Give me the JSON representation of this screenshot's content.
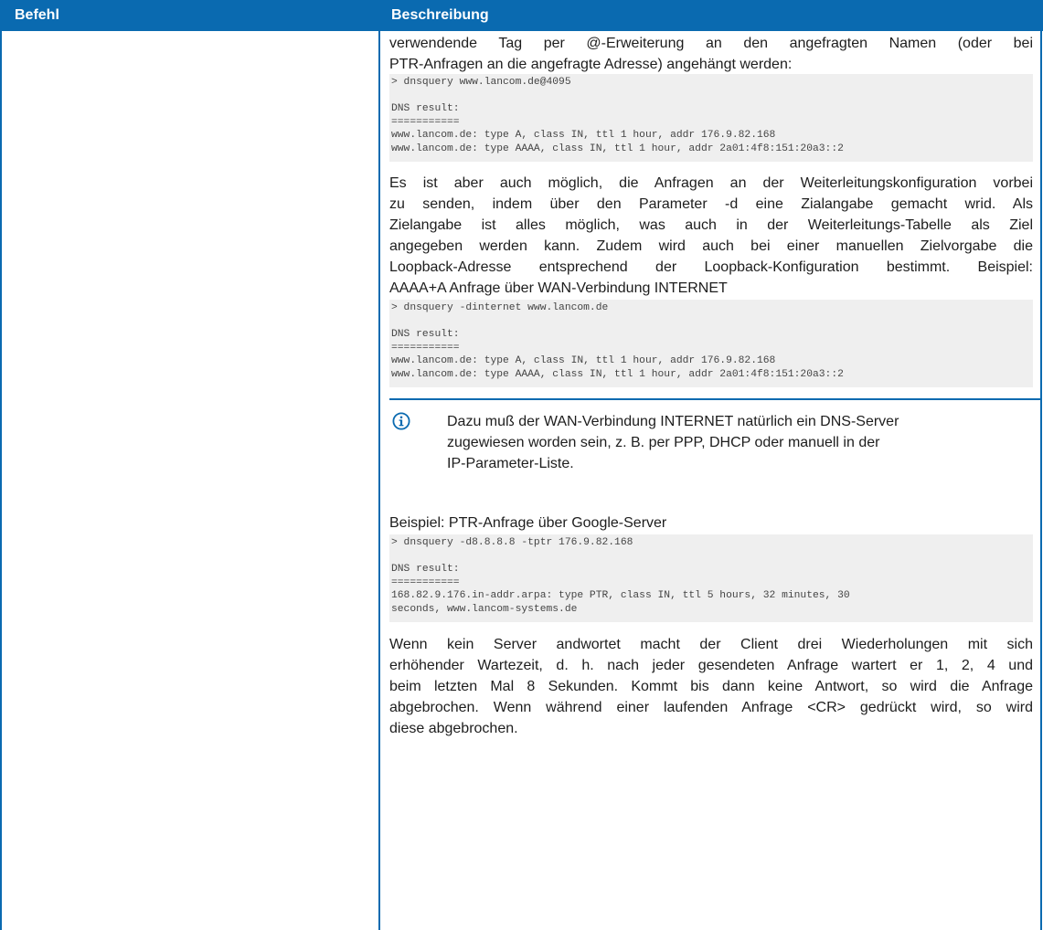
{
  "table": {
    "header": {
      "command": "Befehl",
      "description": "Beschreibung"
    }
  },
  "content": {
    "intro_lines": [
      "verwendende Tag per @-Erweiterung an den angefragten Namen (oder bei",
      "PTR-Anfragen an die angefragte Adresse) angehängt werden:"
    ],
    "code1": "> dnsquery www.lancom.de@4095\n\nDNS result:\n===========\nwww.lancom.de: type A, class IN, ttl 1 hour, addr 176.9.82.168\nwww.lancom.de: type AAAA, class IN, ttl 1 hour, addr 2a01:4f8:151:20a3::2",
    "para2_lines": [
      "Es ist aber auch möglich, die Anfragen an der Weiterleitungskonfiguration vorbei",
      "zu senden, indem über den Parameter -d eine Zialangabe gemacht wrid. Als",
      "Zielangabe ist alles möglich, was auch in der Weiterleitungs-Tabelle als Ziel",
      "angegeben werden kann. Zudem wird auch bei einer manuellen Zielvorgabe die",
      "Loopback-Adresse entsprechend der Loopback-Konfiguration bestimmt. Beispiel:",
      "AAAA+A Anfrage über WAN-Verbindung INTERNET"
    ],
    "code2": "> dnsquery -dinternet www.lancom.de\n\nDNS result:\n===========\nwww.lancom.de: type A, class IN, ttl 1 hour, addr 176.9.82.168\nwww.lancom.de: type AAAA, class IN, ttl 1 hour, addr 2a01:4f8:151:20a3::2",
    "note": {
      "icon": "info-icon",
      "lines": [
        "Dazu muß der WAN-Verbindung INTERNET natürlich ein DNS-Server",
        "zugewiesen worden sein, z. B. per PPP, DHCP oder manuell in der",
        "IP-Parameter-Liste."
      ]
    },
    "para3": "Beispiel: PTR-Anfrage über Google-Server",
    "code3": "> dnsquery -d8.8.8.8 -tptr 176.9.82.168\n\nDNS result:\n===========\n168.82.9.176.in-addr.arpa: type PTR, class IN, ttl 5 hours, 32 minutes, 30\nseconds, www.lancom-systems.de",
    "para4_lines": [
      "Wenn kein Server andwortet macht der Client drei Wiederholungen mit sich",
      "erhöhender Wartezeit, d. h. nach jeder gesendeten Anfrage wartert er 1, 2, 4 und",
      "beim letzten Mal 8 Sekunden. Kommt bis dann keine Antwort, so wird die Anfrage",
      "abgebrochen. Wenn während einer laufenden Anfrage <CR> gedrückt wird, so wird",
      "diese abgebrochen."
    ]
  },
  "colors": {
    "accent": "#0a6ab0",
    "code_bg": "#efefef"
  }
}
